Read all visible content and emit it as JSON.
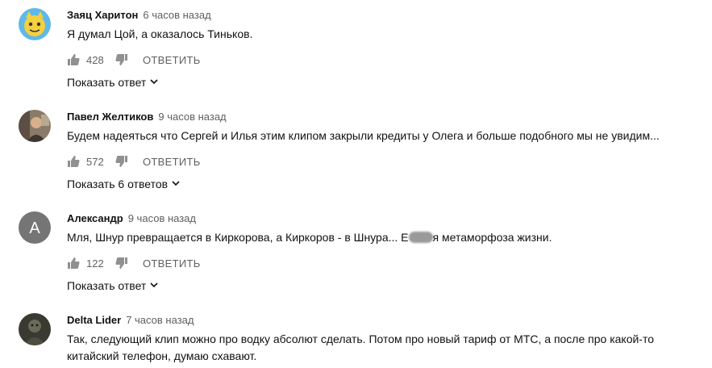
{
  "comments": [
    {
      "author": "Заяц Харитон",
      "time": "6 часов назад",
      "text": "Я думал Цой, а оказалось Тиньков.",
      "likes": "428",
      "reply_label": "ОТВЕТИТЬ",
      "replies_label": "Показать ответ",
      "avatar": "cartoon-face"
    },
    {
      "author": "Павел Желтиков",
      "time": "9 часов назад",
      "text": "Будем надеяться что Сергей и Илья этим клипом закрыли кредиты у Олега и больше подобного мы не увидим...",
      "likes": "572",
      "reply_label": "ОТВЕТИТЬ",
      "replies_label": "Показать 6 ответов",
      "avatar": "photo"
    },
    {
      "author": "Александр",
      "time": "9 часов назад",
      "text_before": "Мля, Шнур превращается в Киркорова, а Киркоров -  в Шнура... Е",
      "text_after": "я метаморфоза жизни.",
      "likes": "122",
      "reply_label": "ОТВЕТИТЬ",
      "replies_label": "Показать ответ",
      "avatar_letter": "A",
      "avatar_color": "#757575"
    },
    {
      "author": "Delta Lider",
      "time": "7 часов назад",
      "text_line1": "Так, следующий клип можно про водку абсолют сделать. Потом про новый тариф от МТС, а после про какой-то",
      "text_line2": "китайский телефон, думаю схавают.",
      "avatar": "dark-photo"
    }
  ]
}
